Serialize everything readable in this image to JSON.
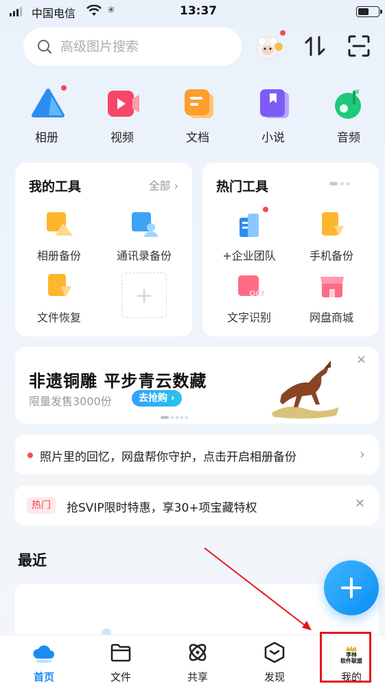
{
  "status_bar": {
    "carrier": "中国电信",
    "time": "13:37",
    "battery_level": 0.55
  },
  "search": {
    "placeholder": "高级图片搜索"
  },
  "categories": [
    {
      "label": "相册",
      "icon": "album-icon",
      "color": "#2d8cf0",
      "badge": true
    },
    {
      "label": "视频",
      "icon": "video-icon",
      "color": "#f5476a",
      "badge": false
    },
    {
      "label": "文档",
      "icon": "document-icon",
      "color": "#ff9d2e",
      "badge": false
    },
    {
      "label": "小说",
      "icon": "novel-icon",
      "color": "#7c5cf6",
      "badge": false
    },
    {
      "label": "音频",
      "icon": "audio-icon",
      "color": "#1fc87a",
      "badge": false
    }
  ],
  "my_tools": {
    "title": "我的工具",
    "more": "全部",
    "items": [
      {
        "label": "相册备份",
        "icon": "album-backup-icon"
      },
      {
        "label": "通讯录备份",
        "icon": "contacts-backup-icon"
      },
      {
        "label": "文件恢复",
        "icon": "file-recovery-icon"
      }
    ]
  },
  "hot_tools": {
    "title": "热门工具",
    "items": [
      {
        "label": "+企业团队",
        "icon": "enterprise-team-icon",
        "badge": true
      },
      {
        "label": "手机备份",
        "icon": "phone-backup-icon",
        "badge": false
      },
      {
        "label": "文字识别",
        "icon": "ocr-icon",
        "badge": false
      },
      {
        "label": "网盘商城",
        "icon": "store-icon",
        "badge": false
      }
    ]
  },
  "banner": {
    "title": "非遗铜雕 平步青云数藏",
    "subtitle": "限量发售3000份",
    "button": "去抢购",
    "close": "×"
  },
  "notices": [
    {
      "text": "照片里的回忆，网盘帮你守护，点击开启相册备份"
    },
    {
      "tag": "热门",
      "text": "抢SVIP限时特惠，享30+项宝藏特权"
    }
  ],
  "recent": {
    "title": "最近"
  },
  "tabs": [
    {
      "label": "首页",
      "icon": "home-cloud-icon",
      "active": true
    },
    {
      "label": "文件",
      "icon": "folder-icon",
      "active": false
    },
    {
      "label": "共享",
      "icon": "share-atom-icon",
      "active": false
    },
    {
      "label": "发现",
      "icon": "discover-icon",
      "active": false
    },
    {
      "label": "我的",
      "icon": "profile-avatar-icon",
      "active": false
    }
  ],
  "mine_avatar_text": [
    "李林",
    "软件联盟"
  ],
  "colors": {
    "accent": "#1c8cf0",
    "badge_red": "#f04b5b",
    "annotation_red": "#e8141c"
  }
}
